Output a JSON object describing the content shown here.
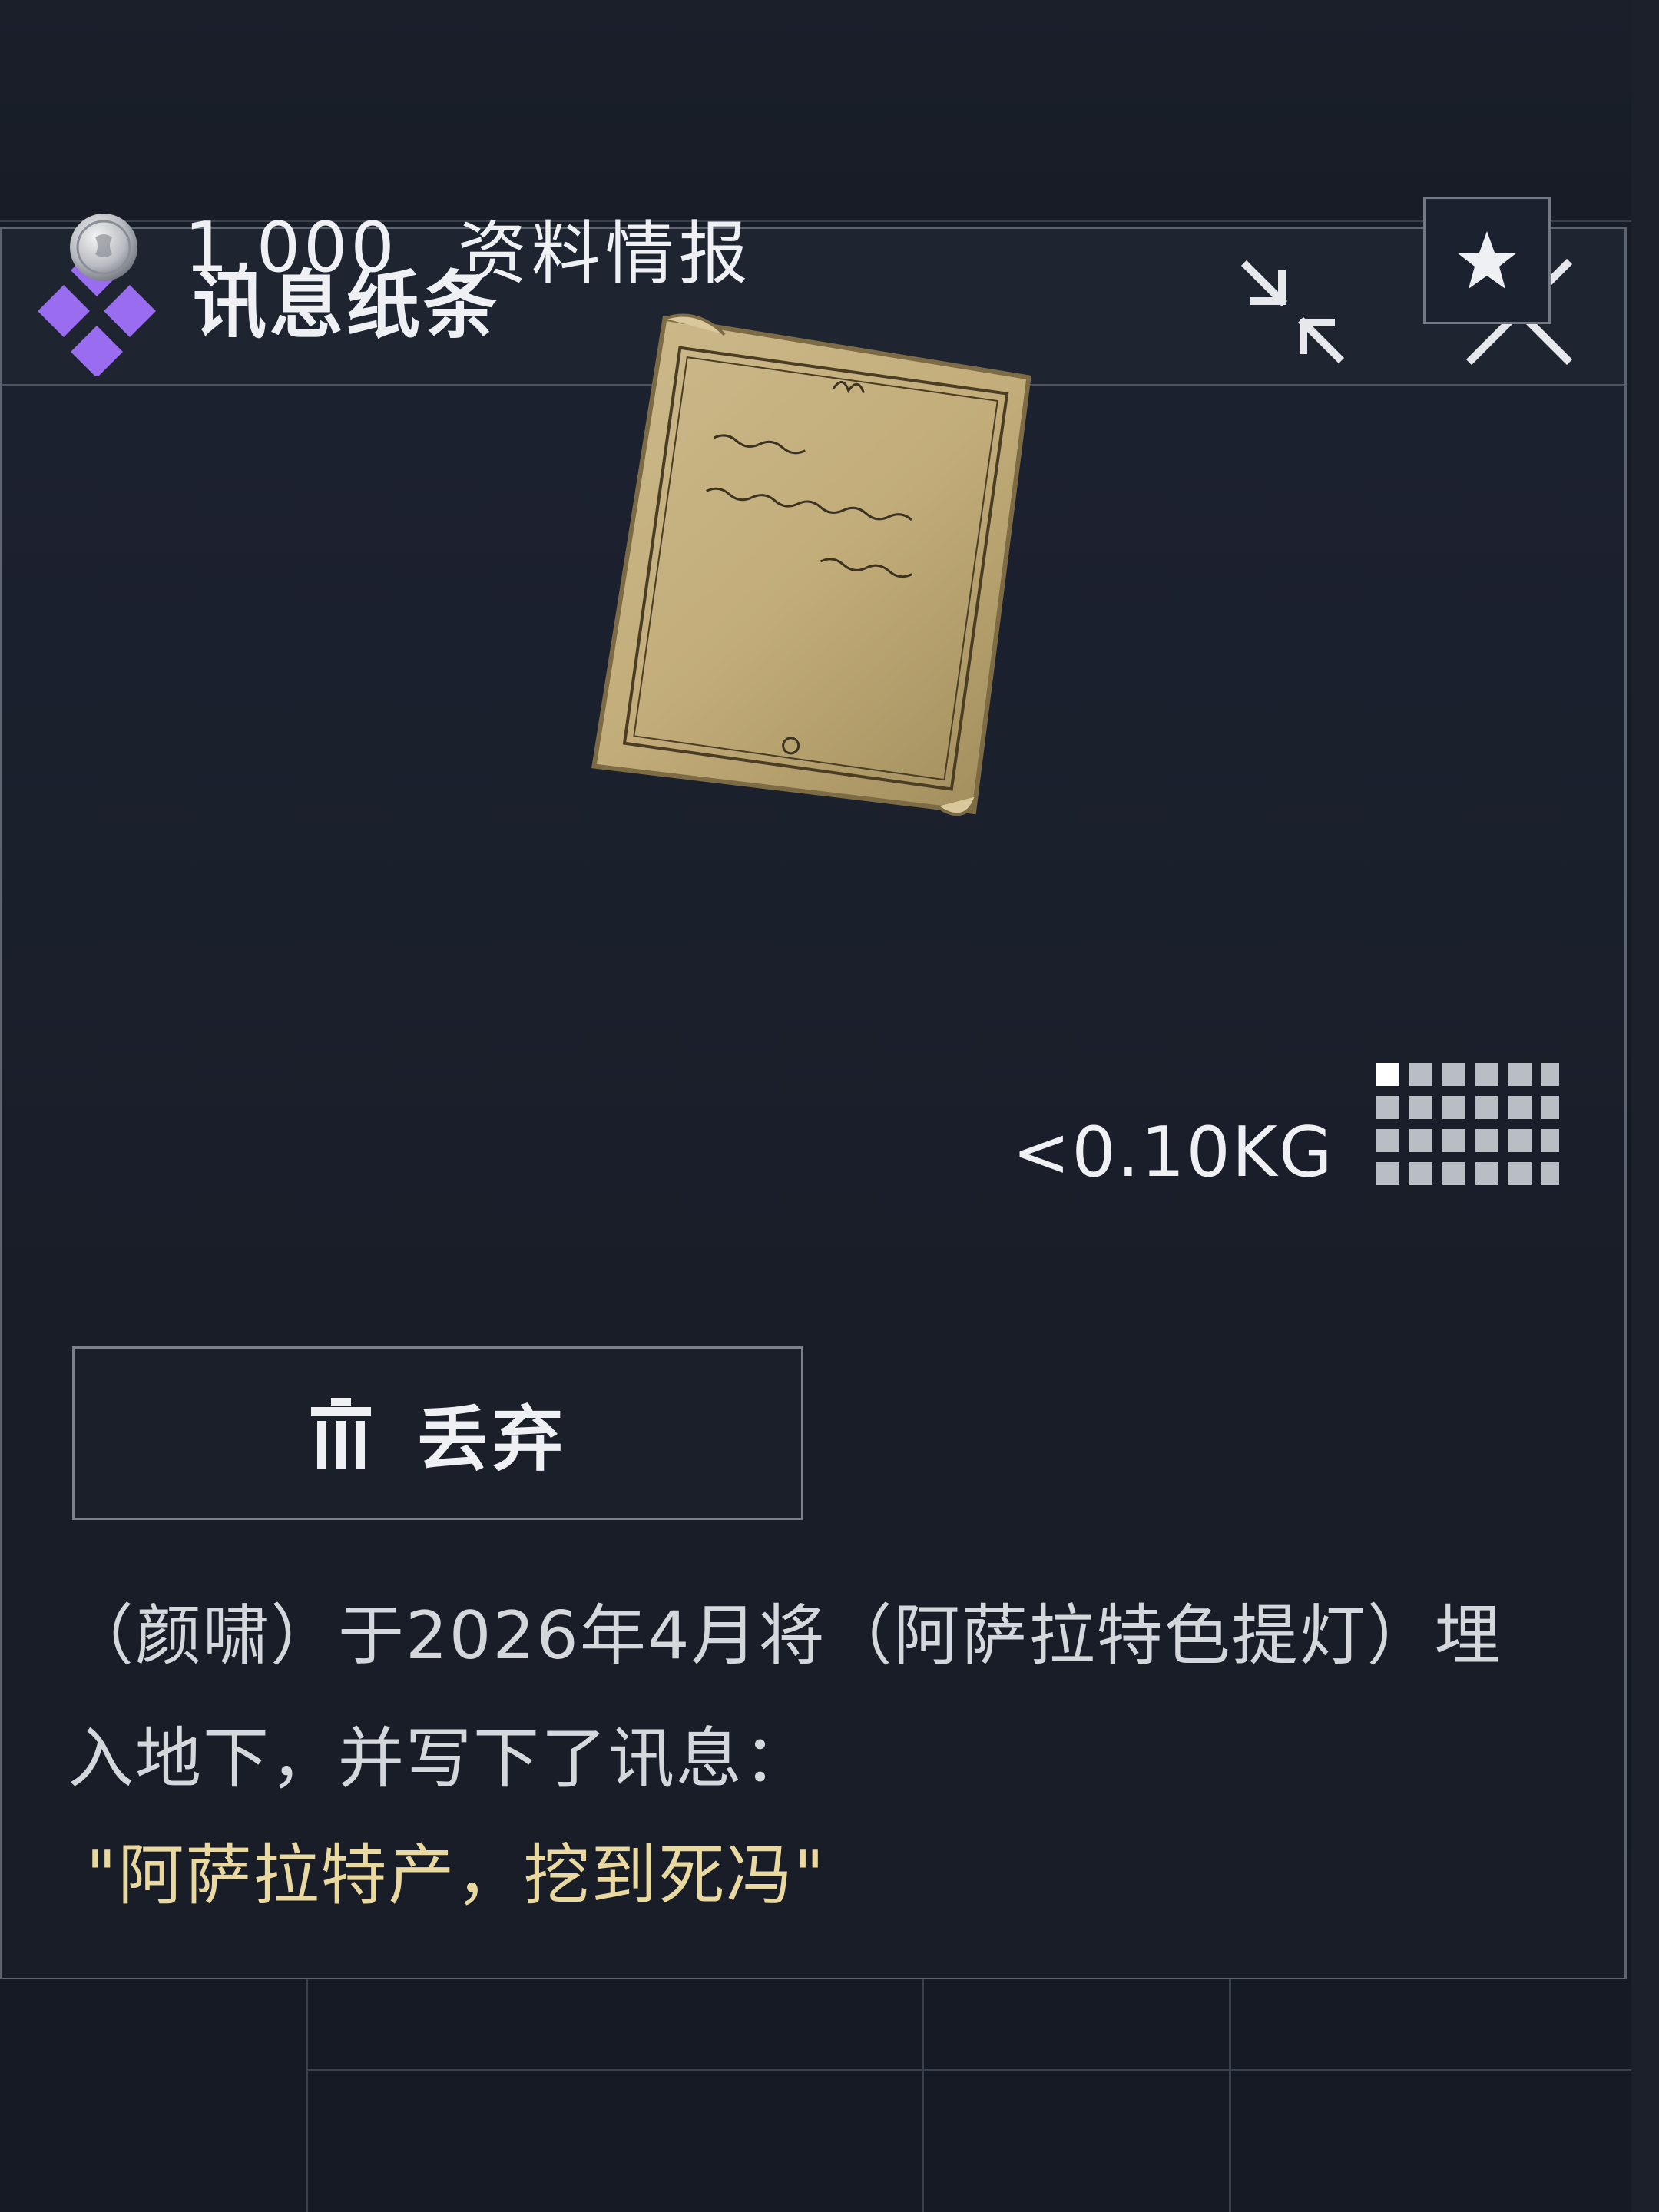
{
  "panel": {
    "title": "讯息纸条",
    "rarity_color": "#9a6cf0",
    "price": "1,000",
    "category": "资料情报",
    "weight": "<0.10KG",
    "grid_size": {
      "cols": 6,
      "rows": 4
    }
  },
  "header_actions": {
    "collapse_icon": "collapse-arrows-icon",
    "close_icon": "close-icon"
  },
  "actions": {
    "discard_label": "丢弃",
    "discard_icon": "trash-icon",
    "favorite_icon": "star-icon"
  },
  "description": {
    "text": "（颜啸）于2026年4月将（阿萨拉特色提灯）埋入地下，并写下了讯息：",
    "quote": "\"阿萨拉特产，挖到死冯\""
  },
  "colors": {
    "accent_quote": "#e9d9a0",
    "panel_border": "#5d6470"
  }
}
